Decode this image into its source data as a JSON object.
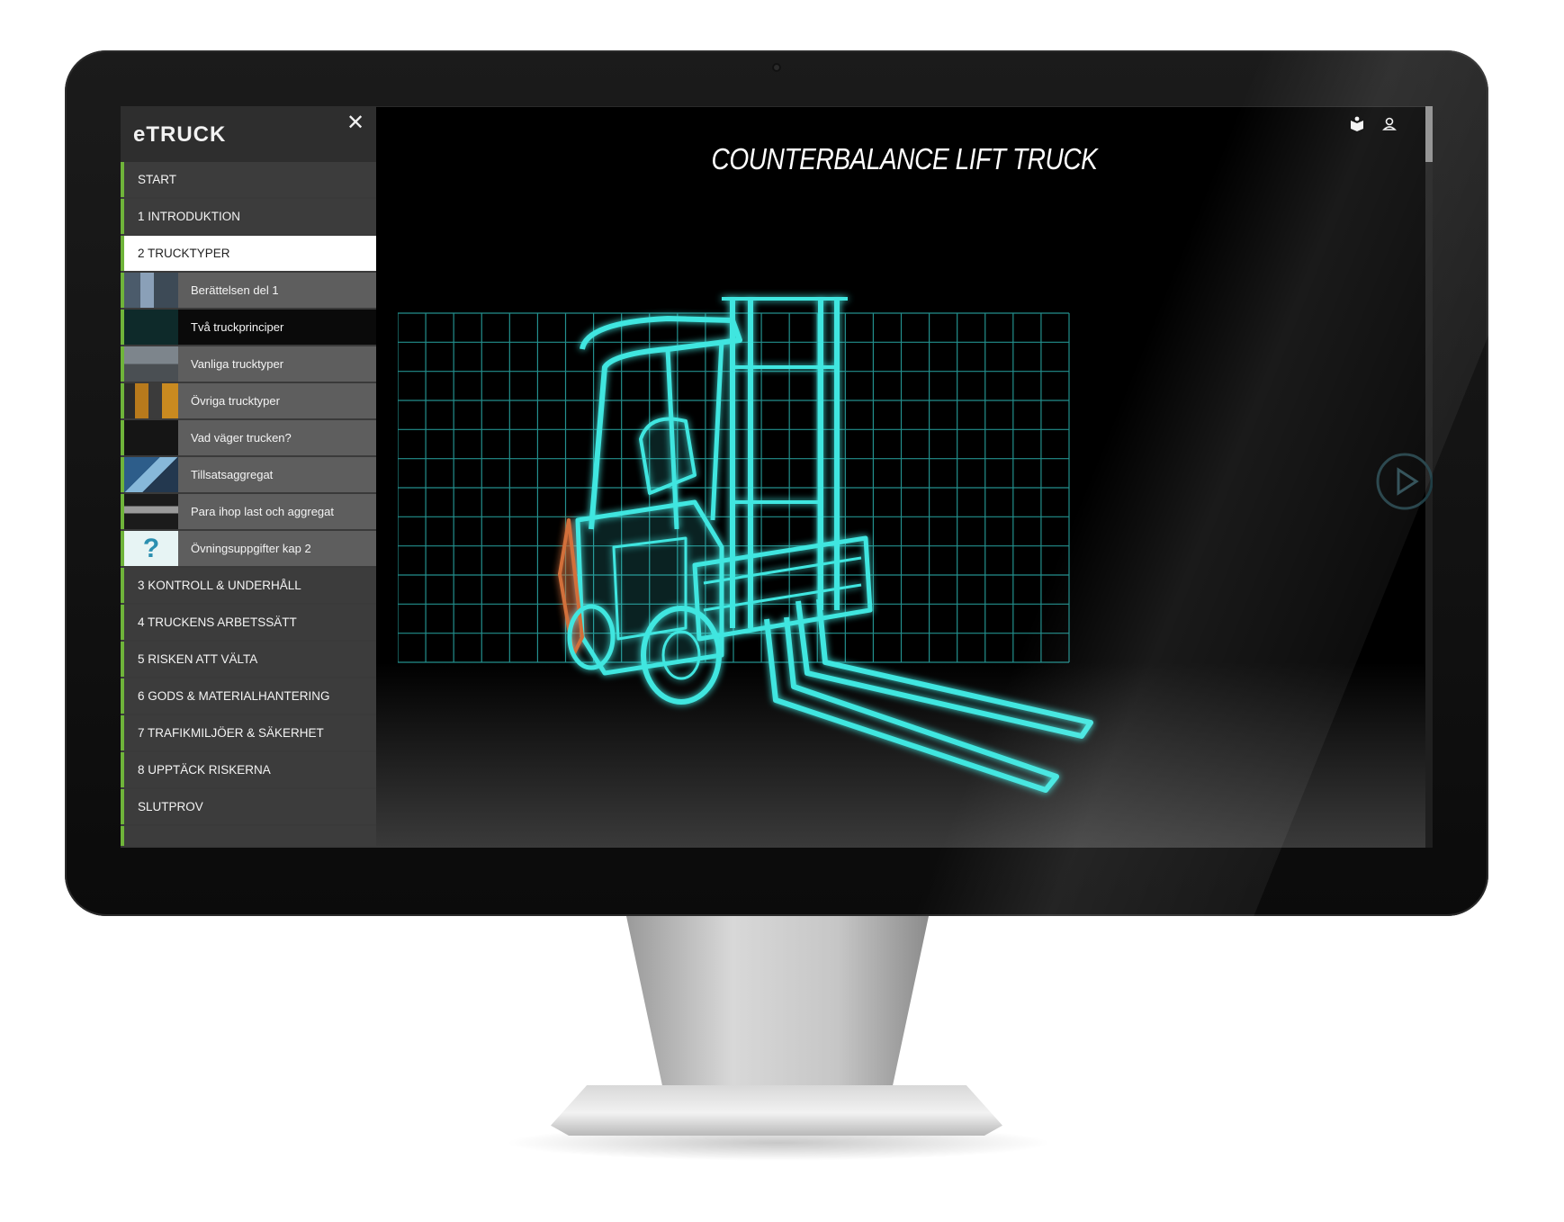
{
  "app": {
    "logo": "eTRUCK",
    "title": "COUNTERBALANCE LIFT TRUCK"
  },
  "sidebar": {
    "close_icon": "close-icon",
    "chapters_before": [
      {
        "label": "START"
      },
      {
        "label": "1 INTRODUKTION"
      },
      {
        "label": "2 TRUCKTYPER",
        "active": true
      }
    ],
    "subitems": [
      {
        "label": "Berättelsen del 1",
        "thumb": "t1"
      },
      {
        "label": "Två truckprinciper",
        "thumb": "t2",
        "active": true
      },
      {
        "label": "Vanliga trucktyper",
        "thumb": "t3"
      },
      {
        "label": "Övriga trucktyper",
        "thumb": "t4"
      },
      {
        "label": "Vad väger trucken?",
        "thumb": "t5"
      },
      {
        "label": "Tillsatsaggregat",
        "thumb": "t6"
      },
      {
        "label": "Para ihop last och aggregat",
        "thumb": "t7"
      },
      {
        "label": "Övningsuppgifter kap 2",
        "thumb": "t8",
        "thumb_text": "?"
      }
    ],
    "chapters_after": [
      {
        "label": "3 KONTROLL & UNDERHÅLL"
      },
      {
        "label": "4 TRUCKENS ARBETSSÄTT"
      },
      {
        "label": "5 RISKEN ATT VÄLTA"
      },
      {
        "label": "6 GODS & MATERIALHANTERING"
      },
      {
        "label": "7 TRAFIKMILJÖER & SÄKERHET"
      },
      {
        "label": "8 UPPTÄCK RISKERNA"
      },
      {
        "label": "SLUTPROV"
      }
    ]
  },
  "toolbar": {
    "book_icon": "book-icon",
    "user_icon": "user-icon"
  },
  "colors": {
    "accent_green": "#6fb43a",
    "hologram_cyan": "#3fe6e0"
  }
}
